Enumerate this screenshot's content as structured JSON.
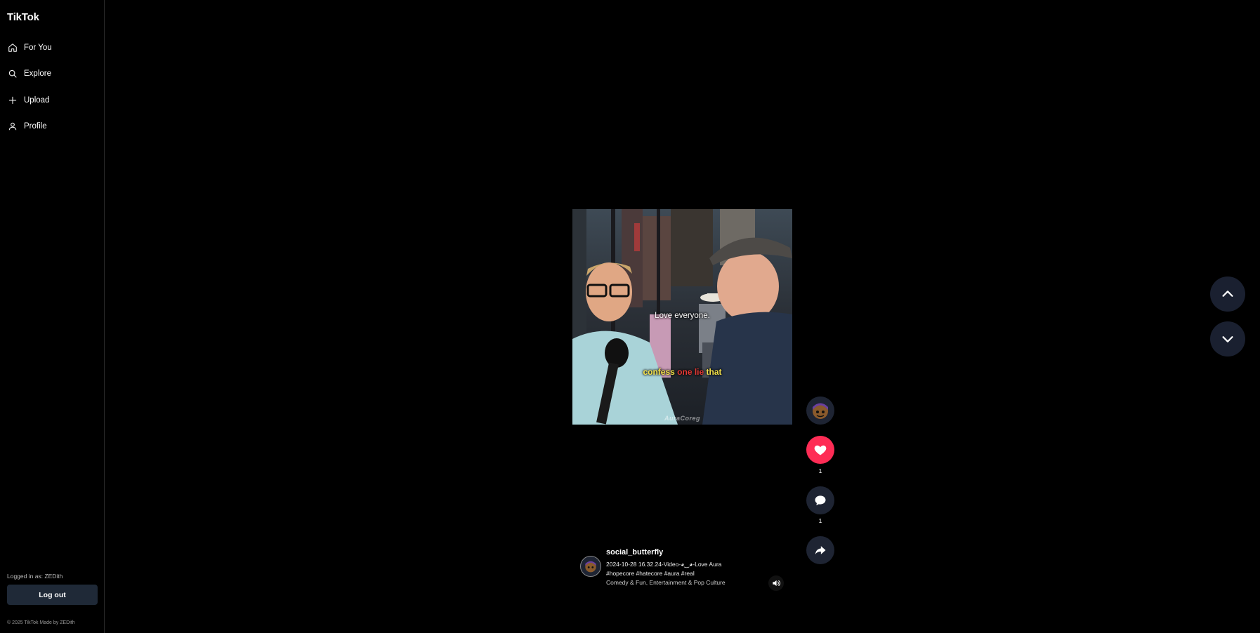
{
  "app": {
    "brand": "TikTok"
  },
  "sidebar": {
    "items": [
      {
        "label": "For You",
        "icon": "home-icon"
      },
      {
        "label": "Explore",
        "icon": "search-icon"
      },
      {
        "label": "Upload",
        "icon": "plus-icon"
      },
      {
        "label": "Profile",
        "icon": "user-icon"
      }
    ],
    "logged_in_text": "Logged in as: ZEDith",
    "logout_label": "Log out",
    "footer": "© 2025 TikTok Made by ZEDith"
  },
  "video": {
    "caption_line1": "Love everyone.",
    "caption_line2": {
      "word1": "confess",
      "word2": "one lie",
      "word3": "that"
    },
    "watermark": "AuraCoreg"
  },
  "actions": {
    "like_count": "1",
    "comment_count": "1",
    "like_color": "#fe2c55"
  },
  "post": {
    "username": "social_butterfly",
    "description_line1": "2024-10-28 16.32.24-Video-◕‿◕-Love Aura",
    "description_line2": "#hopecore #hatecore #aura #real",
    "categories": "Comedy & Fun, Entertainment & Pop Culture"
  },
  "icons": {
    "like": "heart-icon",
    "comment": "comment-icon",
    "share": "share-icon",
    "sound": "volume-icon",
    "prev": "chevron-up-icon",
    "next": "chevron-down-icon"
  }
}
